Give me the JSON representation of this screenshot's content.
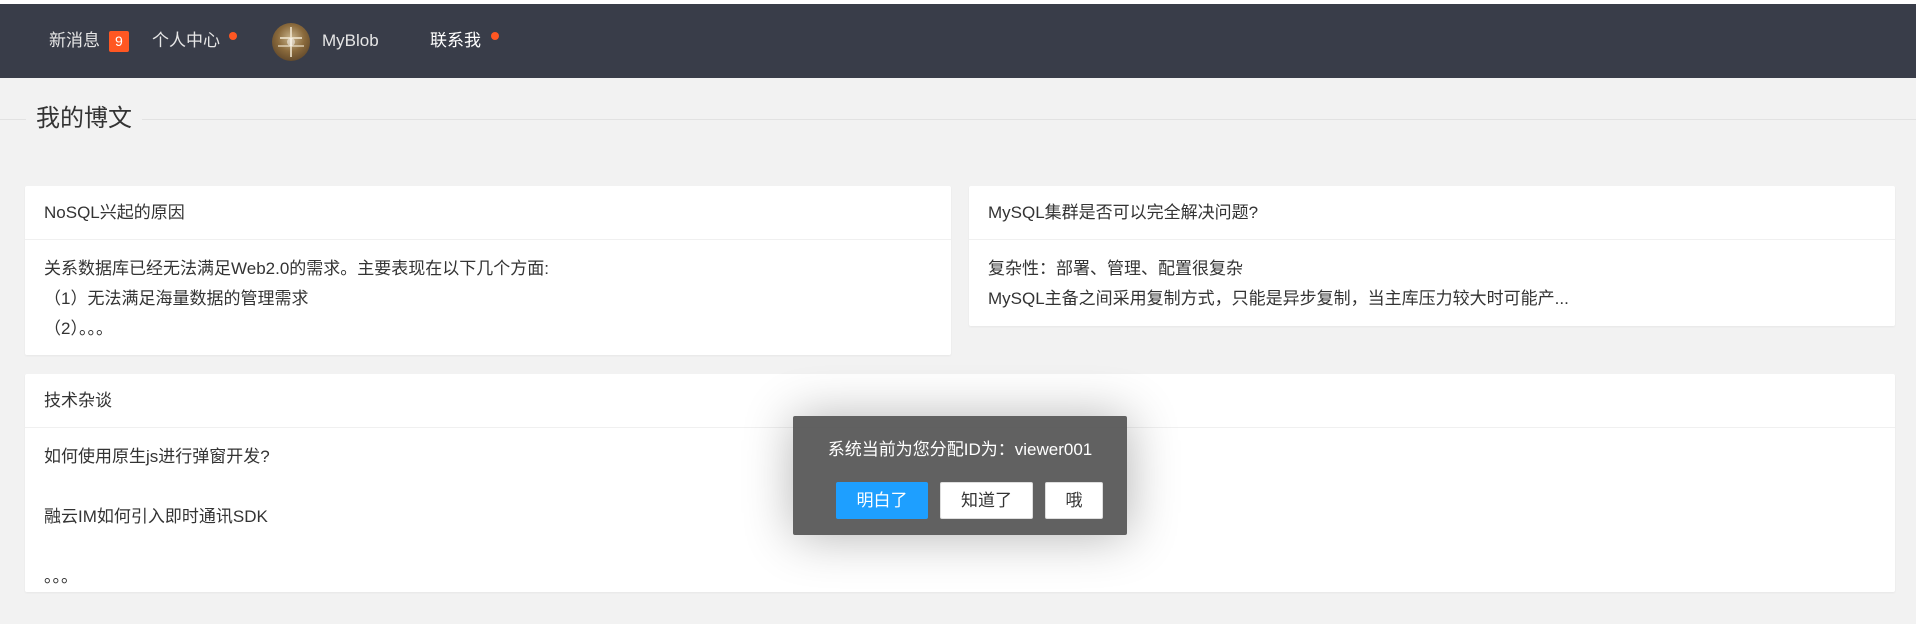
{
  "nav": {
    "messages_label": "新消息",
    "messages_count": "9",
    "personal_center": "个人中心",
    "brand": "MyBlob",
    "contact": "联系我",
    "dot_color": "#ff5722",
    "bg_color": "#393d49"
  },
  "section": {
    "title": "我的博文"
  },
  "cards": [
    {
      "title": "NoSQL兴起的原因",
      "lines": [
        "关系数据库已经无法满足Web2.0的需求。主要表现在以下几个方面:",
        "（1）无法满足海量数据的管理需求",
        "（2）。。。"
      ]
    },
    {
      "title": "MySQL集群是否可以完全解决问题?",
      "lines": [
        "复杂性：部署、管理、配置很复杂",
        "MySQL主备之间采用复制方式，只能是异步复制，当主库压力较大时可能产..."
      ]
    },
    {
      "title": "技术杂谈",
      "lines": [
        "如何使用原生js进行弹窗开发?",
        "",
        "融云IM如何引入即时通讯SDK",
        "",
        "。。。"
      ]
    }
  ],
  "dialog": {
    "message": "系统当前为您分配ID为：viewer001",
    "buttons": [
      "明白了",
      "知道了",
      "哦"
    ],
    "primary_color": "#1e9fff"
  }
}
